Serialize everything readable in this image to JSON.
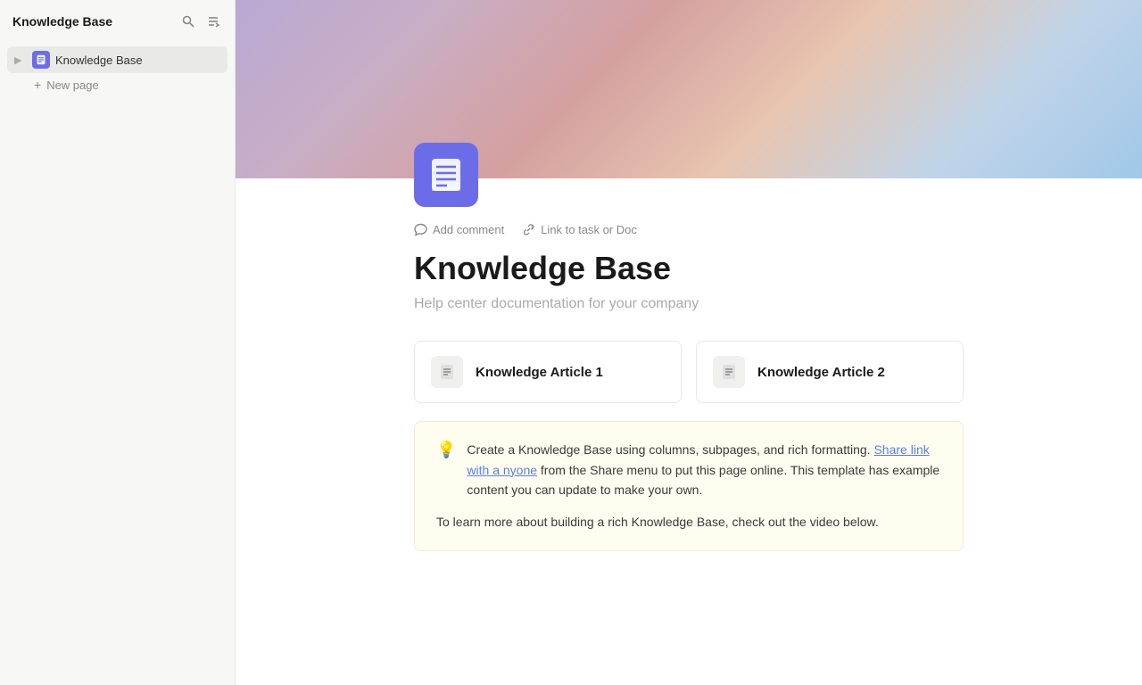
{
  "sidebar": {
    "title": "Knowledge Base",
    "search_label": "Search",
    "collapse_label": "Collapse sidebar",
    "nav_items": [
      {
        "id": "knowledge-base",
        "label": "Knowledge Base",
        "icon": "book-icon",
        "active": true
      }
    ],
    "new_page_label": "New page"
  },
  "cover": {
    "alt": "Colorful gradient cover"
  },
  "page": {
    "icon_alt": "Knowledge Base document icon",
    "action_comment": "Add comment",
    "action_link": "Link to task or Doc",
    "title": "Knowledge Base",
    "subtitle": "Help center documentation for your company"
  },
  "cards": [
    {
      "id": "article-1",
      "title": "Knowledge Article 1",
      "icon": "document-icon"
    },
    {
      "id": "article-2",
      "title": "Knowledge Article 2",
      "icon": "document-icon"
    }
  ],
  "info_box": {
    "bulb": "💡",
    "text_before_link": "Create a Knowledge Base using columns, subpages, and rich formatting. ",
    "link_text": "Share link with a nyone",
    "link_href": "#",
    "text_after_link": " from the Share menu to put this page online. This template has example content you can update to make your own.",
    "text2": "To learn more about building a rich Knowledge Base, check out the video below."
  }
}
